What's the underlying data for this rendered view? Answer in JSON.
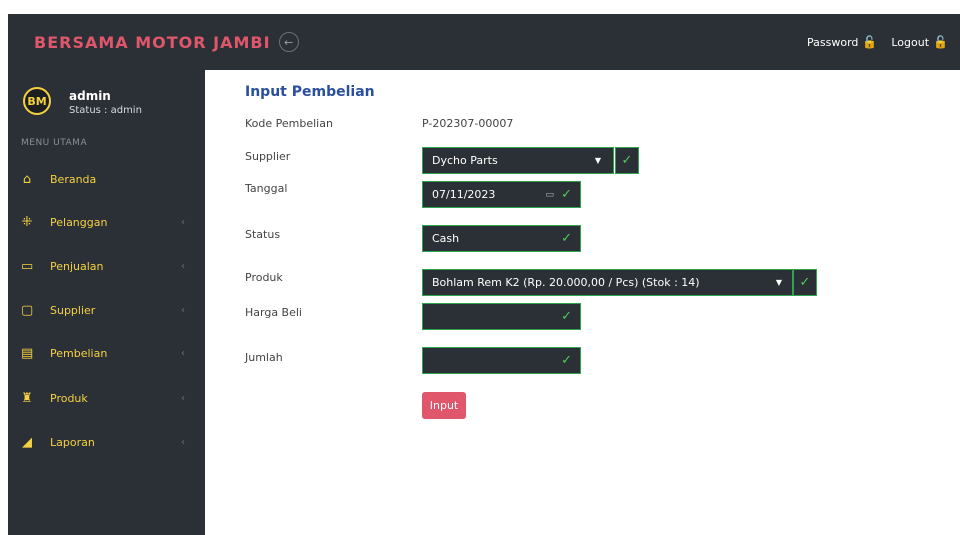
{
  "header": {
    "brand": "BERSAMA MOTOR JAMBI",
    "toggle_icon": "←",
    "links": [
      {
        "label": "Password",
        "icon": "🔓"
      },
      {
        "label": "Logout",
        "icon": "🔓"
      }
    ]
  },
  "sidebar": {
    "avatar_text": "BM",
    "user_name": "admin",
    "user_status": "Status : admin",
    "menu_header": "MENU UTAMA",
    "items": [
      {
        "label": "Beranda",
        "icon": "⌂",
        "chevron": ""
      },
      {
        "label": "Pelanggan",
        "icon": "⁜",
        "chevron": "‹"
      },
      {
        "label": "Penjualan",
        "icon": "▭",
        "chevron": "‹"
      },
      {
        "label": "Supplier",
        "icon": "▢",
        "chevron": "‹"
      },
      {
        "label": "Pembelian",
        "icon": "▤",
        "chevron": "‹"
      },
      {
        "label": "Produk",
        "icon": "♜",
        "chevron": "‹"
      },
      {
        "label": "Laporan",
        "icon": "◢",
        "chevron": "‹"
      }
    ]
  },
  "form": {
    "title": "Input Pembelian",
    "kode_label": "Kode Pembelian",
    "kode_value": "P-202307-00007",
    "supplier_label": "Supplier",
    "supplier_value": "Dycho Parts",
    "tanggal_label": "Tanggal",
    "tanggal_value": "07/11/2023",
    "status_label": "Status",
    "status_value": "Cash",
    "produk_label": "Produk",
    "produk_value": "Bohlam Rem K2 (Rp. 20.000,00 / Pcs) (Stok : 14)",
    "harga_label": "Harga Beli",
    "harga_value": "",
    "jumlah_label": "Jumlah",
    "jumlah_value": "",
    "submit_label": "Input",
    "check_glyph": "✓",
    "caret_glyph": "▼",
    "calendar_glyph": "▭"
  },
  "colors": {
    "topbar": "#2b2f36",
    "brand": "#e0566b",
    "menu_text": "#f5d142",
    "valid_border": "#2ea44f",
    "title": "#2a4f9e",
    "button": "#e0566b"
  }
}
